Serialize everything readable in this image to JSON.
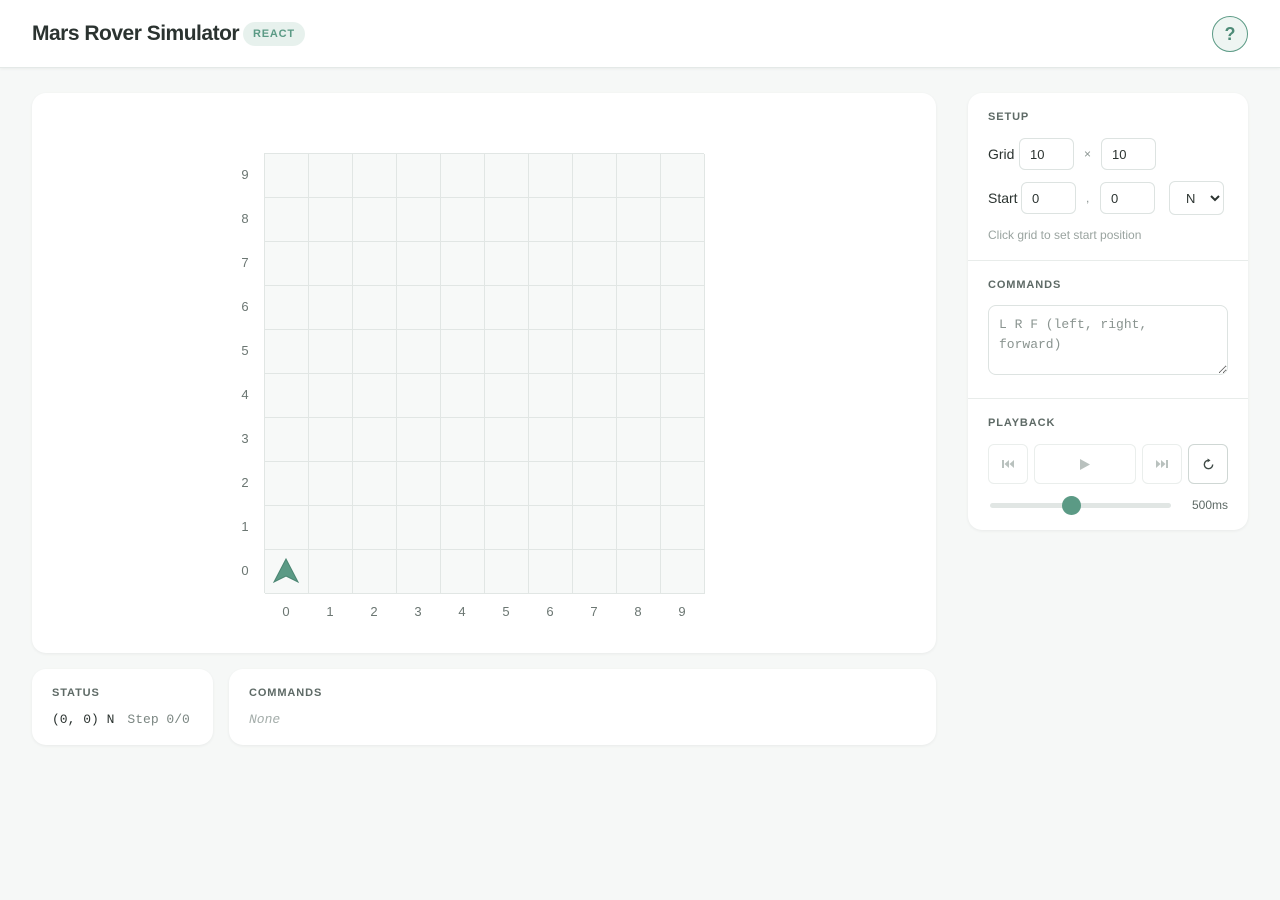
{
  "header": {
    "title": "Mars Rover Simulator",
    "badge": "REACT",
    "help_label": "?"
  },
  "grid": {
    "columns": 10,
    "rows": 10,
    "x_labels": [
      "0",
      "1",
      "2",
      "3",
      "4",
      "5",
      "6",
      "7",
      "8",
      "9"
    ],
    "y_labels": [
      "9",
      "8",
      "7",
      "6",
      "5",
      "4",
      "3",
      "2",
      "1",
      "0"
    ],
    "rover": {
      "x": 0,
      "y": 0,
      "direction": "N",
      "icon": "rover-arrow-icon",
      "color": "#5b9a85"
    }
  },
  "setup": {
    "section_label": "SETUP",
    "grid_label": "Grid",
    "grid_width": "10",
    "grid_separator": "×",
    "grid_height": "10",
    "start_label": "Start",
    "start_x": "0",
    "start_separator": ",",
    "start_y": "0",
    "direction_selected": "N",
    "hint": "Click grid to set start position"
  },
  "commands": {
    "section_label": "COMMANDS",
    "placeholder": "L R F (left, right, forward)",
    "value": ""
  },
  "playback": {
    "section_label": "PLAYBACK",
    "icons": {
      "start": "skip-to-start-icon",
      "play": "play-icon",
      "end": "skip-to-end-icon",
      "reset": "reset-icon"
    },
    "speed_fraction": 0.45,
    "speed_label": "500ms"
  },
  "status": {
    "section_label": "STATUS",
    "position": "(0, 0) N",
    "step": "Step 0/0"
  },
  "command_list": {
    "section_label": "COMMANDS",
    "empty_text": "None"
  },
  "colors": {
    "accent": "#5b9a85",
    "background": "#f6f8f7"
  }
}
